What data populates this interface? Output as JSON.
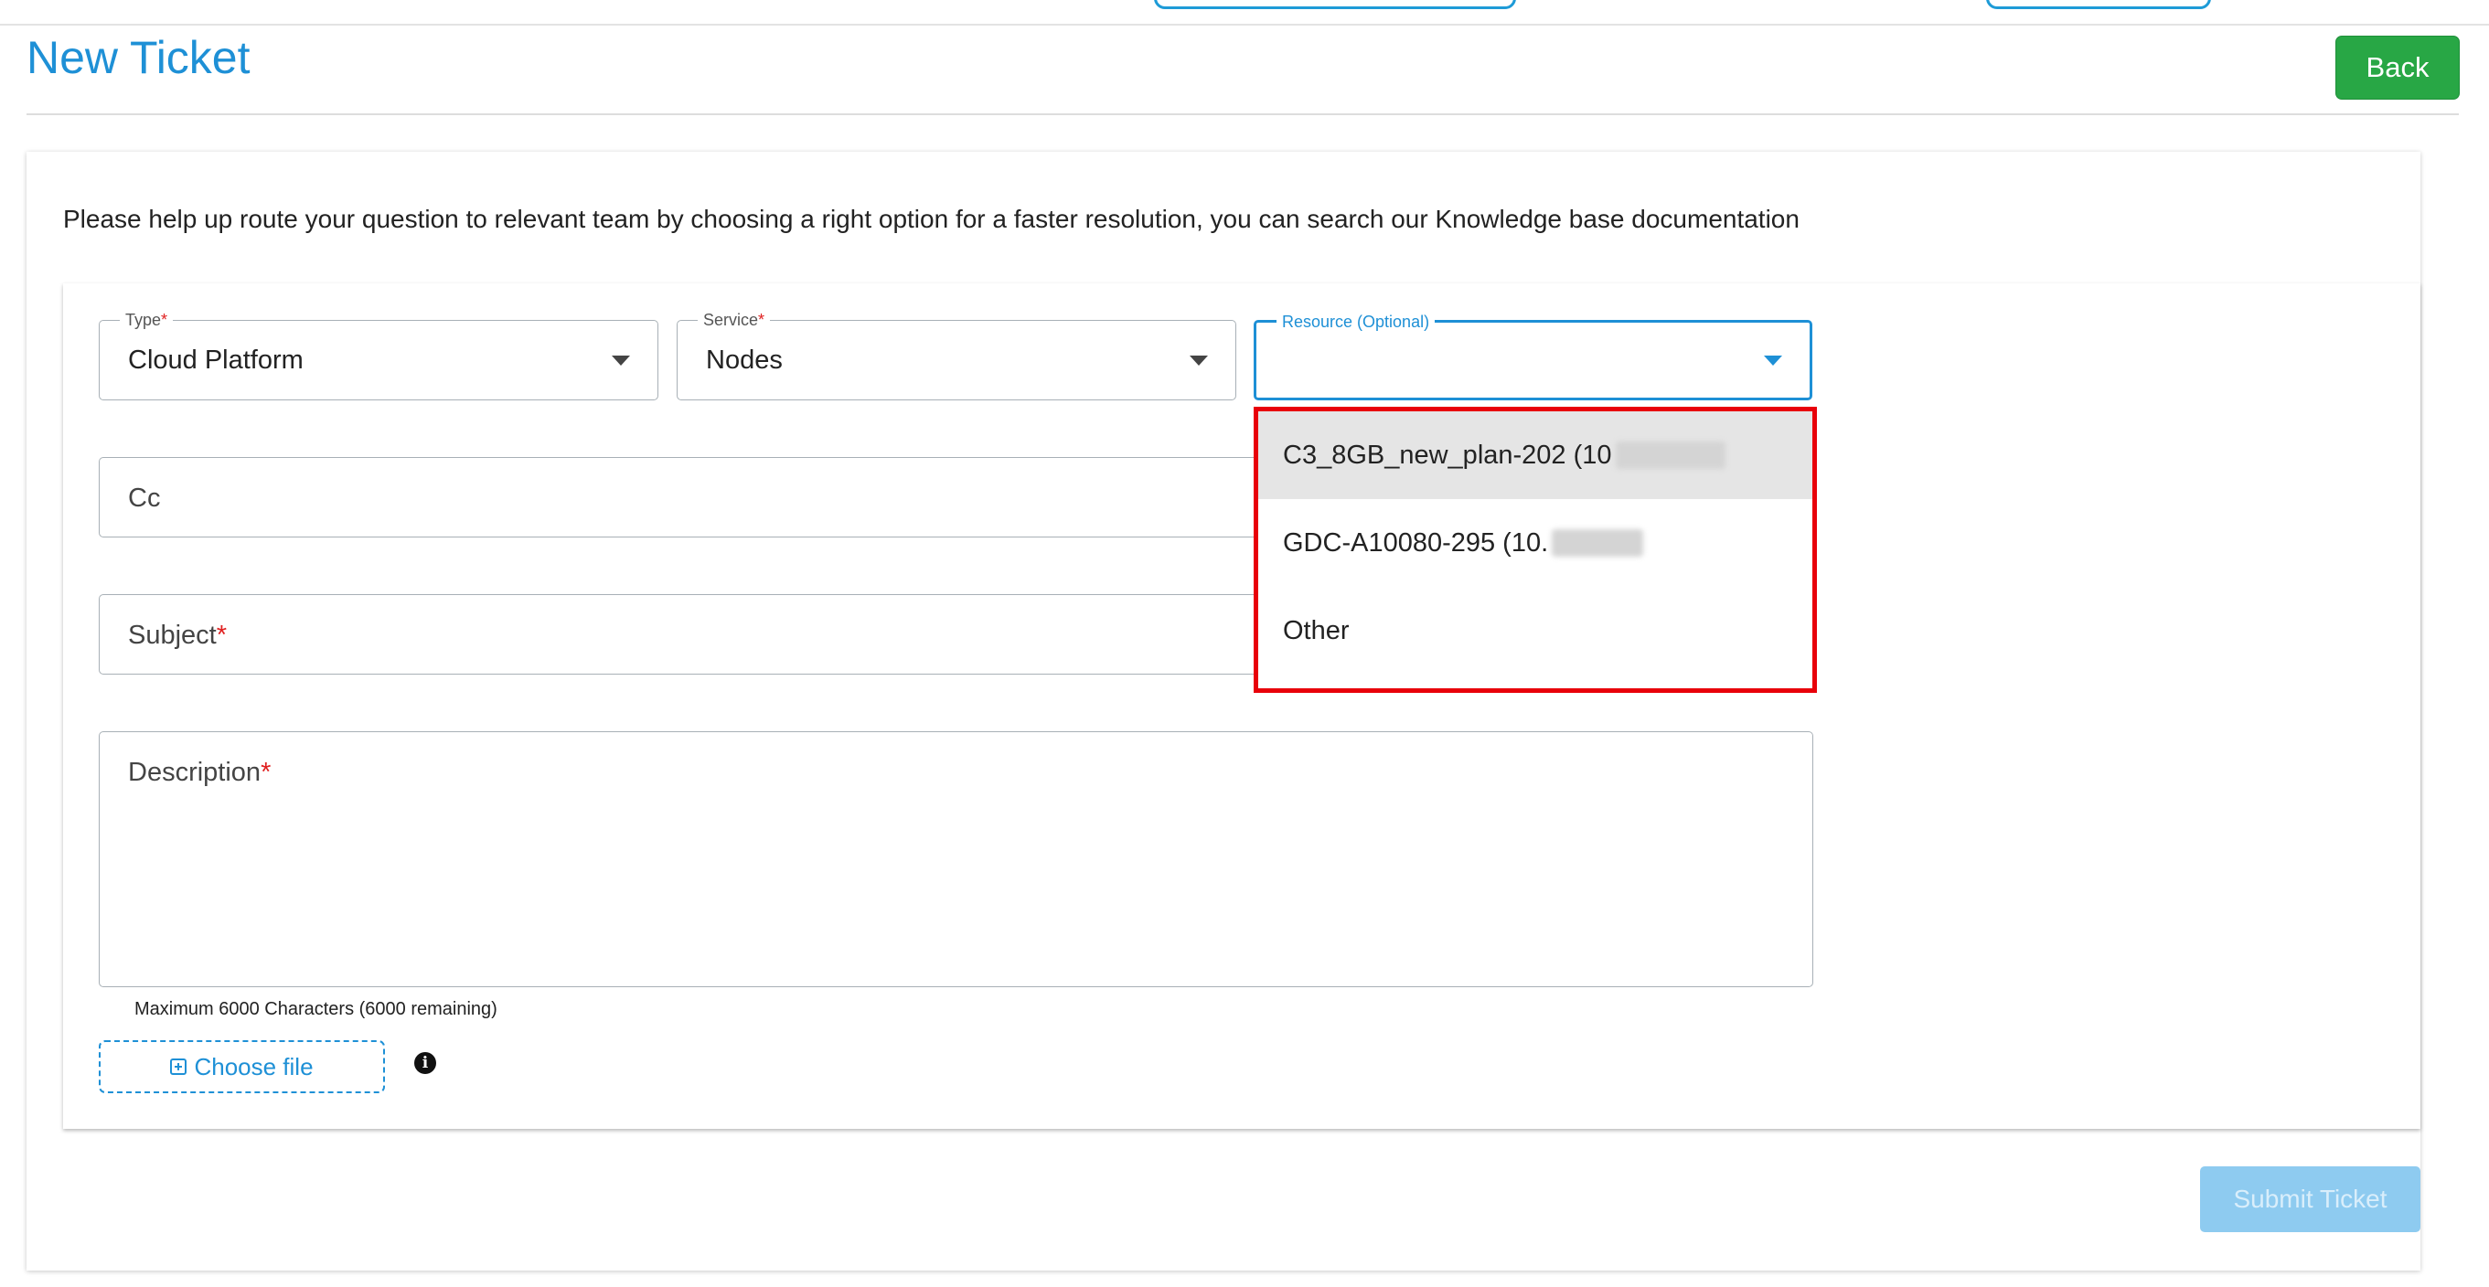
{
  "page": {
    "title": "New Ticket"
  },
  "header": {
    "back_label": "Back"
  },
  "intro": {
    "text": "Please help up route your question to relevant team by choosing a right option for a faster resolution, you can search our Knowledge base documentation"
  },
  "form": {
    "type": {
      "label": "Type",
      "required_mark": "*",
      "value": "Cloud Platform"
    },
    "service": {
      "label": "Service",
      "required_mark": "*",
      "value": "Nodes"
    },
    "resource": {
      "label": "Resource (Optional)",
      "value": ""
    },
    "cc": {
      "placeholder": "Cc"
    },
    "subject": {
      "placeholder": "Subject",
      "required_mark": "*"
    },
    "description": {
      "placeholder": "Description",
      "required_mark": "*"
    },
    "char_hint": "Maximum 6000 Characters (6000 remaining)",
    "choose_file_label": "Choose file",
    "info_glyph": "i",
    "submit_label": "Submit Ticket"
  },
  "resource_dropdown": {
    "options": [
      {
        "label": "C3_8GB_new_plan-202 (10",
        "redacted": true
      },
      {
        "label": "GDC-A10080-295 (10.",
        "redacted": true
      },
      {
        "label": "Other",
        "redacted": false
      }
    ],
    "highlight_color": "#e8000a"
  },
  "colors": {
    "accent": "#1e90d6",
    "back_button": "#28a745",
    "submit_disabled": "#8ecbf0",
    "required": "#e02020"
  }
}
